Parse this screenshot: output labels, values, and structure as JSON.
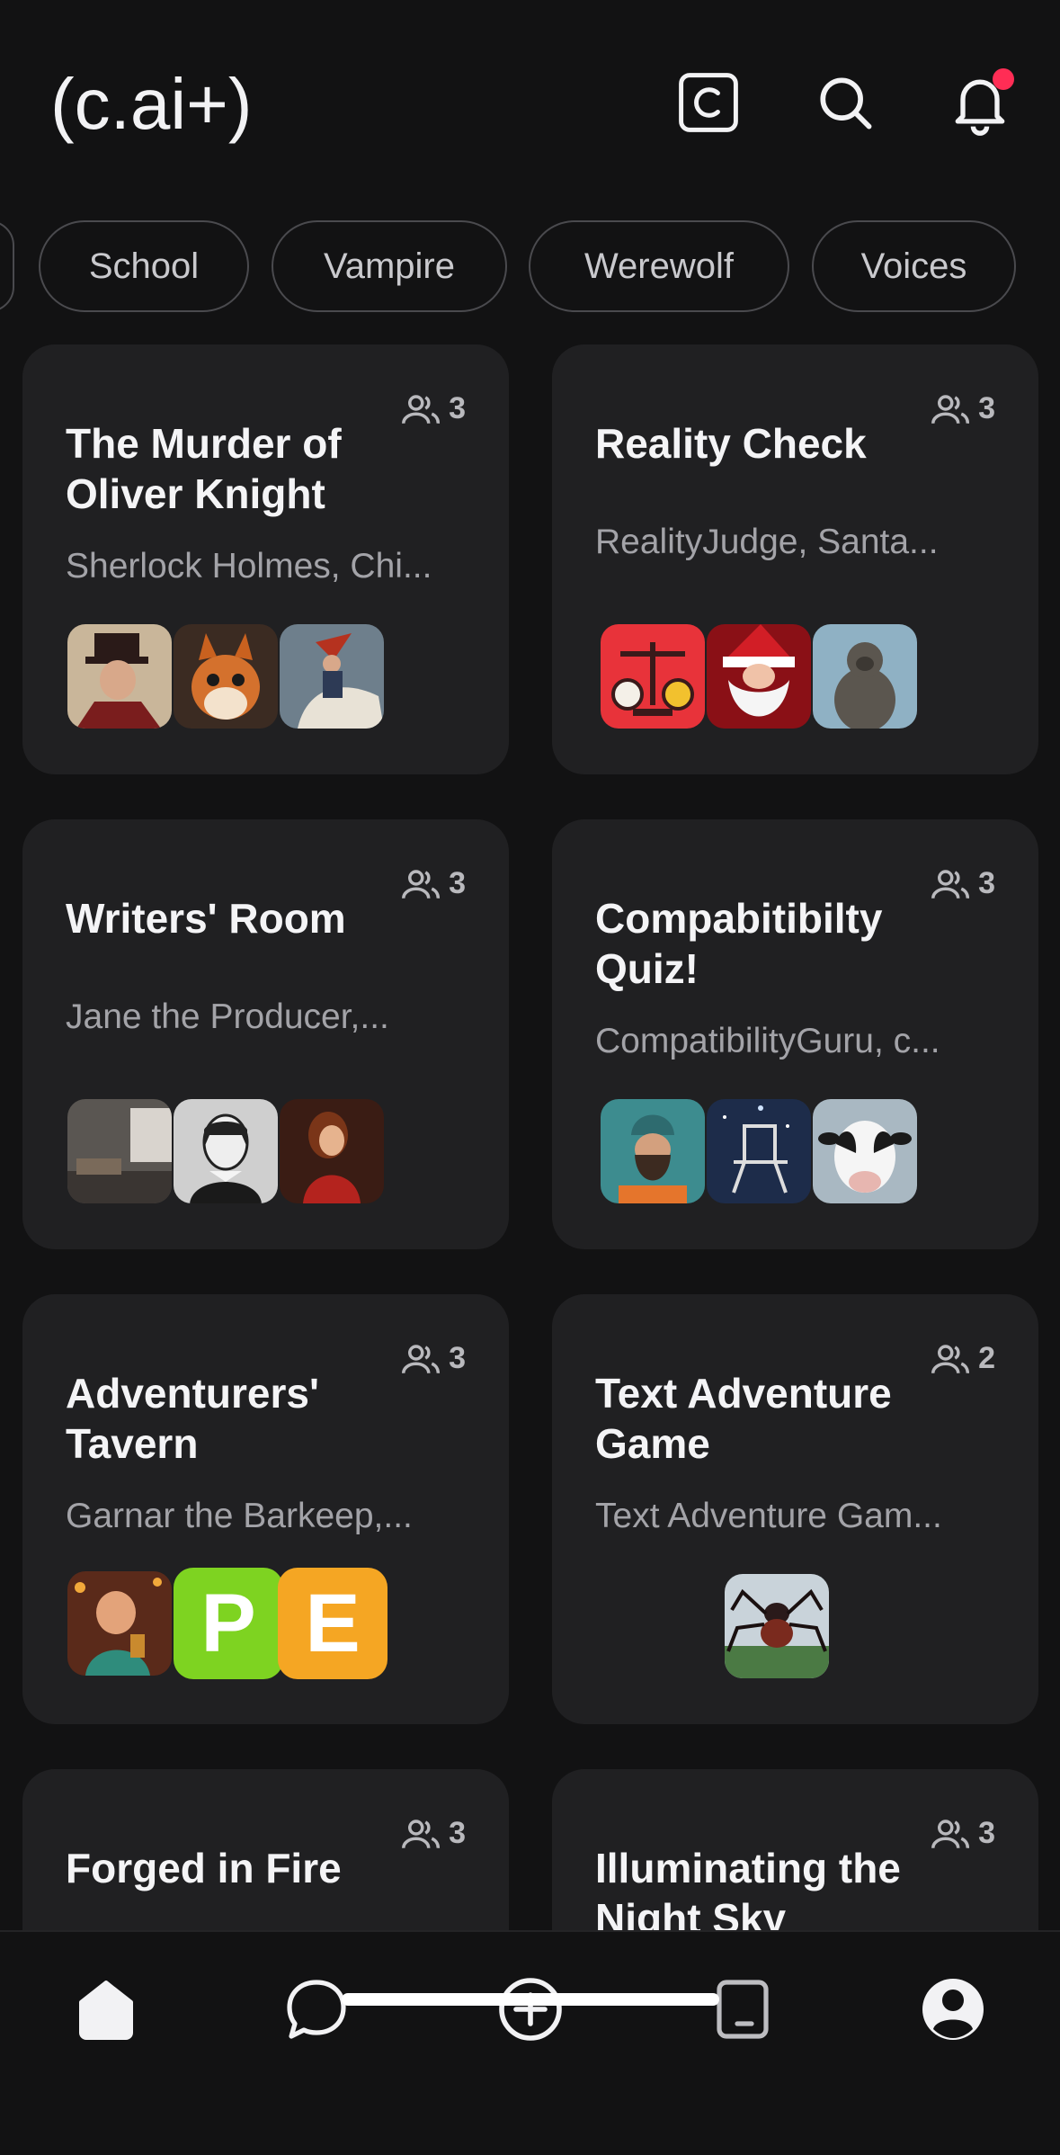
{
  "header": {
    "logo": "(c.ai+)",
    "icons": [
      "c-plus-icon",
      "search-icon",
      "bell-icon"
    ],
    "has_notification": true
  },
  "chips": [
    "School",
    "Vampire",
    "Werewolf",
    "Voices"
  ],
  "cards": [
    {
      "title": "The Murder of Oliver Knight",
      "subtitle": "Sherlock Holmes, Chi...",
      "members": "3",
      "avatars": [
        "detective-avatar",
        "squirrel-avatar",
        "napoleon-avatar"
      ]
    },
    {
      "title": "Reality Check",
      "subtitle": "RealityJudge, Santa...",
      "members": "3",
      "avatars": [
        "scales-avatar",
        "santa-avatar",
        "bigfoot-avatar"
      ]
    },
    {
      "title": "Writers' Room",
      "subtitle": "Jane the Producer,...",
      "members": "3",
      "avatars": [
        "studio-avatar",
        "shakespeare-avatar",
        "woman-red-dress-avatar"
      ]
    },
    {
      "title": "Compabitibilty Quiz!",
      "subtitle": "CompatibilityGuru, c...",
      "members": "3",
      "avatars": [
        "bearded-man-avatar",
        "chair-avatar",
        "cow-avatar"
      ]
    },
    {
      "title": "Adventurers' Tavern",
      "subtitle": "Garnar the Barkeep,...",
      "members": "3",
      "avatars": [
        "barkeep-avatar",
        "p-letter-avatar",
        "e-letter-avatar"
      ],
      "letters": {
        "p": "P",
        "e": "E"
      }
    },
    {
      "title": "Text Adventure Game",
      "subtitle": "Text Adventure Gam...",
      "members": "2",
      "avatars": [
        "spider-avatar"
      ]
    },
    {
      "title": "Forged in Fire",
      "subtitle": "",
      "members": "3",
      "avatars": []
    },
    {
      "title": "Illuminating the Night Sky",
      "subtitle": "",
      "members": "3",
      "avatars": []
    }
  ],
  "nav": [
    "home-icon",
    "chat-icon",
    "create-icon",
    "feed-icon",
    "profile-icon"
  ],
  "colors": {
    "background": "#121213",
    "card": "#202022",
    "accent_dot": "#ff2d55",
    "p_tile": "#7ed321",
    "e_tile": "#f5a623"
  }
}
